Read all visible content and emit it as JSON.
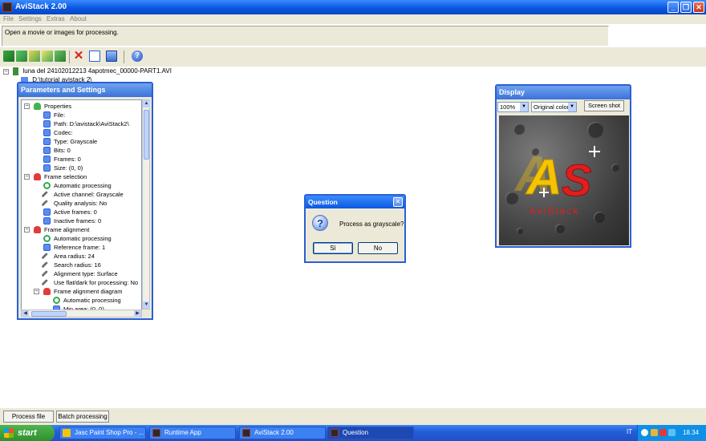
{
  "window": {
    "title": "AviStack 2.00",
    "minimize": "_",
    "maximize": "❐",
    "close": "✕"
  },
  "menu": [
    "File",
    "Settings",
    "Extras",
    "About"
  ],
  "status_message": "Open a movie or images for processing.",
  "toolbar": {
    "buttons": [
      "open-movie",
      "open-images",
      "save-project",
      "load-project",
      "export",
      "delete",
      "new-document",
      "save",
      "help"
    ]
  },
  "file_tree": {
    "root": "luna del 24102012213 4apotmec_00000-PART1.AVI",
    "child": "D:\\tutorial avistack 2\\"
  },
  "parameters_panel": {
    "title": "Parameters and Settings",
    "rows": [
      {
        "label": "Properties",
        "indent": 0,
        "icon": "folder-green",
        "expander": "−"
      },
      {
        "label": "File:",
        "indent": 1,
        "icon": "doc"
      },
      {
        "label": "Path: D:\\avistack\\AviStack2\\",
        "indent": 1,
        "icon": "doc"
      },
      {
        "label": "Codec:",
        "indent": 1,
        "icon": "doc"
      },
      {
        "label": "Type: Grayscale",
        "indent": 1,
        "icon": "doc"
      },
      {
        "label": "Bits: 0",
        "indent": 1,
        "icon": "doc"
      },
      {
        "label": "Frames: 0",
        "indent": 1,
        "icon": "doc"
      },
      {
        "label": "Size: (0, 0)",
        "indent": 1,
        "icon": "doc"
      },
      {
        "label": "Frame selection",
        "indent": 0,
        "icon": "folder-red",
        "expander": "−"
      },
      {
        "label": "Automatic processing",
        "indent": 1,
        "icon": "gear"
      },
      {
        "label": "Active channel: Grayscale",
        "indent": 1,
        "icon": "wrench"
      },
      {
        "label": "Quality analysis: No",
        "indent": 1,
        "icon": "wrench"
      },
      {
        "label": "Active frames: 0",
        "indent": 1,
        "icon": "doc"
      },
      {
        "label": "Inactive frames: 0",
        "indent": 1,
        "icon": "doc"
      },
      {
        "label": "Frame alignment",
        "indent": 0,
        "icon": "folder-red",
        "expander": "−"
      },
      {
        "label": "Automatic processing",
        "indent": 1,
        "icon": "gear"
      },
      {
        "label": "Reference frame: 1",
        "indent": 1,
        "icon": "doc"
      },
      {
        "label": "Area radius: 24",
        "indent": 1,
        "icon": "wrench"
      },
      {
        "label": "Search radius: 16",
        "indent": 1,
        "icon": "wrench"
      },
      {
        "label": "Alignment type: Surface",
        "indent": 1,
        "icon": "wrench"
      },
      {
        "label": "Use flat/dark for processing: No",
        "indent": 1,
        "icon": "wrench"
      },
      {
        "label": "Frame alignment diagram",
        "indent": 1,
        "icon": "folder-red",
        "expander": "−"
      },
      {
        "label": "Automatic processing",
        "indent": 2,
        "icon": "gear"
      },
      {
        "label": "Min area: (0, 0)",
        "indent": 2,
        "icon": "doc"
      }
    ]
  },
  "display_panel": {
    "title": "Display",
    "zoom": "100%",
    "color_mode": "Original color",
    "screenshot_label": "Screen shot",
    "logo_letters": "AS",
    "logo_text": "AviStack"
  },
  "dialog": {
    "title": "Question",
    "message": "Process as grayscale?",
    "yes_label": "Sì",
    "no_label": "No"
  },
  "bottom_buttons": {
    "process_file": "Process file",
    "batch_processing": "Batch processing"
  },
  "taskbar": {
    "start_label": "start",
    "tasks": [
      "Jasc Paint Shop Pro - ...",
      "Runtime App",
      "AviStack 2.00",
      "Question"
    ],
    "language": "IT",
    "clock": "18.34"
  },
  "colors": {
    "title_blue": "#0a58e0",
    "panel_bg": "#ece9d8",
    "logo_red": "#e01e1e",
    "logo_yellow": "#f5c400"
  }
}
